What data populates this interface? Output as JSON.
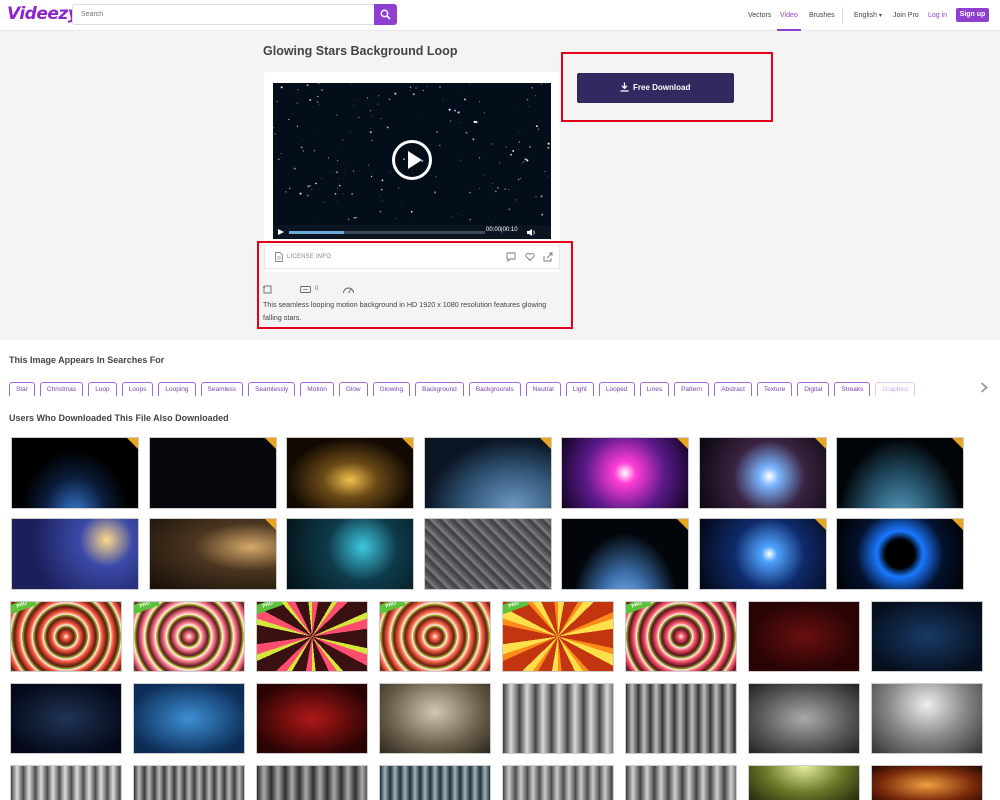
{
  "header": {
    "logo": "Videezy",
    "search_placeholder": "Search",
    "nav": {
      "vectors": "Vectors",
      "video": "Video",
      "brushes": "Brushes",
      "language": "English",
      "join_pro": "Join Pro",
      "login": "Log in",
      "signup": "Sign up"
    }
  },
  "video": {
    "title": "Glowing Stars Background Loop",
    "time": "00:00|00:10",
    "progress": 0.28,
    "license_label": "LICENSE INFO",
    "comment_count": "0",
    "description": "This seamless looping motion background in HD 1920 x 1080 resolution features glowing falling stars."
  },
  "download": {
    "label": "Free Download"
  },
  "searches": {
    "title": "This Image Appears In Searches For",
    "tags": [
      "Star",
      "Christmas",
      "Loop",
      "Loops",
      "Looping",
      "Seamless",
      "Seamlessly",
      "Motion",
      "Glow",
      "Glowing",
      "Background",
      "Backgrounds",
      "Neutral",
      "Light",
      "Looped",
      "Lines",
      "Pattern",
      "Abstract",
      "Texture",
      "Digital",
      "Streaks",
      "Graphics"
    ]
  },
  "also": {
    "title": "Users Who Downloaded This File Also Downloaded"
  },
  "colors": {
    "brand": "#8e3fcf",
    "download_bg": "#33285f",
    "highlight_box": "#e4001b",
    "pro_badge": "#5cc13b",
    "premium_corner": "#e8a623"
  },
  "icons": [
    "search-icon",
    "download-icon",
    "play-icon",
    "volume-icon",
    "license-file-icon",
    "comment-icon",
    "heart-icon",
    "share-icon",
    "resolution-icon",
    "duration-icon",
    "speed-icon",
    "chevron-right-icon"
  ]
}
